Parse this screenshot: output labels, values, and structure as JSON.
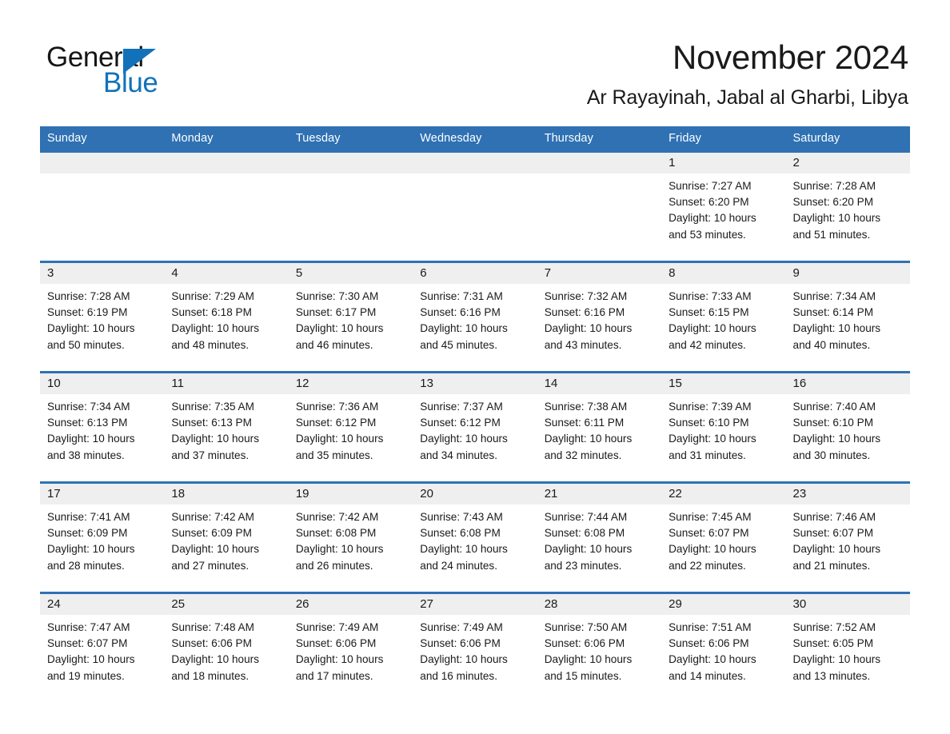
{
  "brand": {
    "name_top": "General",
    "name_bottom": "Blue",
    "accent_color": "#1272b9"
  },
  "header": {
    "title": "November 2024",
    "location": "Ar Rayayinah, Jabal al Gharbi, Libya"
  },
  "theme": {
    "header_blue": "#2f71b3",
    "day_band_gray": "#efefef",
    "text_color": "#1a1a1a"
  },
  "weekdays": [
    "Sunday",
    "Monday",
    "Tuesday",
    "Wednesday",
    "Thursday",
    "Friday",
    "Saturday"
  ],
  "weeks": [
    [
      {
        "day": "",
        "sunrise": "",
        "sunset": "",
        "daylight_line1": "",
        "daylight_line2": "",
        "empty": true
      },
      {
        "day": "",
        "sunrise": "",
        "sunset": "",
        "daylight_line1": "",
        "daylight_line2": "",
        "empty": true
      },
      {
        "day": "",
        "sunrise": "",
        "sunset": "",
        "daylight_line1": "",
        "daylight_line2": "",
        "empty": true
      },
      {
        "day": "",
        "sunrise": "",
        "sunset": "",
        "daylight_line1": "",
        "daylight_line2": "",
        "empty": true
      },
      {
        "day": "",
        "sunrise": "",
        "sunset": "",
        "daylight_line1": "",
        "daylight_line2": "",
        "empty": true
      },
      {
        "day": "1",
        "sunrise": "Sunrise: 7:27 AM",
        "sunset": "Sunset: 6:20 PM",
        "daylight_line1": "Daylight: 10 hours",
        "daylight_line2": "and 53 minutes.",
        "empty": false
      },
      {
        "day": "2",
        "sunrise": "Sunrise: 7:28 AM",
        "sunset": "Sunset: 6:20 PM",
        "daylight_line1": "Daylight: 10 hours",
        "daylight_line2": "and 51 minutes.",
        "empty": false
      }
    ],
    [
      {
        "day": "3",
        "sunrise": "Sunrise: 7:28 AM",
        "sunset": "Sunset: 6:19 PM",
        "daylight_line1": "Daylight: 10 hours",
        "daylight_line2": "and 50 minutes.",
        "empty": false
      },
      {
        "day": "4",
        "sunrise": "Sunrise: 7:29 AM",
        "sunset": "Sunset: 6:18 PM",
        "daylight_line1": "Daylight: 10 hours",
        "daylight_line2": "and 48 minutes.",
        "empty": false
      },
      {
        "day": "5",
        "sunrise": "Sunrise: 7:30 AM",
        "sunset": "Sunset: 6:17 PM",
        "daylight_line1": "Daylight: 10 hours",
        "daylight_line2": "and 46 minutes.",
        "empty": false
      },
      {
        "day": "6",
        "sunrise": "Sunrise: 7:31 AM",
        "sunset": "Sunset: 6:16 PM",
        "daylight_line1": "Daylight: 10 hours",
        "daylight_line2": "and 45 minutes.",
        "empty": false
      },
      {
        "day": "7",
        "sunrise": "Sunrise: 7:32 AM",
        "sunset": "Sunset: 6:16 PM",
        "daylight_line1": "Daylight: 10 hours",
        "daylight_line2": "and 43 minutes.",
        "empty": false
      },
      {
        "day": "8",
        "sunrise": "Sunrise: 7:33 AM",
        "sunset": "Sunset: 6:15 PM",
        "daylight_line1": "Daylight: 10 hours",
        "daylight_line2": "and 42 minutes.",
        "empty": false
      },
      {
        "day": "9",
        "sunrise": "Sunrise: 7:34 AM",
        "sunset": "Sunset: 6:14 PM",
        "daylight_line1": "Daylight: 10 hours",
        "daylight_line2": "and 40 minutes.",
        "empty": false
      }
    ],
    [
      {
        "day": "10",
        "sunrise": "Sunrise: 7:34 AM",
        "sunset": "Sunset: 6:13 PM",
        "daylight_line1": "Daylight: 10 hours",
        "daylight_line2": "and 38 minutes.",
        "empty": false
      },
      {
        "day": "11",
        "sunrise": "Sunrise: 7:35 AM",
        "sunset": "Sunset: 6:13 PM",
        "daylight_line1": "Daylight: 10 hours",
        "daylight_line2": "and 37 minutes.",
        "empty": false
      },
      {
        "day": "12",
        "sunrise": "Sunrise: 7:36 AM",
        "sunset": "Sunset: 6:12 PM",
        "daylight_line1": "Daylight: 10 hours",
        "daylight_line2": "and 35 minutes.",
        "empty": false
      },
      {
        "day": "13",
        "sunrise": "Sunrise: 7:37 AM",
        "sunset": "Sunset: 6:12 PM",
        "daylight_line1": "Daylight: 10 hours",
        "daylight_line2": "and 34 minutes.",
        "empty": false
      },
      {
        "day": "14",
        "sunrise": "Sunrise: 7:38 AM",
        "sunset": "Sunset: 6:11 PM",
        "daylight_line1": "Daylight: 10 hours",
        "daylight_line2": "and 32 minutes.",
        "empty": false
      },
      {
        "day": "15",
        "sunrise": "Sunrise: 7:39 AM",
        "sunset": "Sunset: 6:10 PM",
        "daylight_line1": "Daylight: 10 hours",
        "daylight_line2": "and 31 minutes.",
        "empty": false
      },
      {
        "day": "16",
        "sunrise": "Sunrise: 7:40 AM",
        "sunset": "Sunset: 6:10 PM",
        "daylight_line1": "Daylight: 10 hours",
        "daylight_line2": "and 30 minutes.",
        "empty": false
      }
    ],
    [
      {
        "day": "17",
        "sunrise": "Sunrise: 7:41 AM",
        "sunset": "Sunset: 6:09 PM",
        "daylight_line1": "Daylight: 10 hours",
        "daylight_line2": "and 28 minutes.",
        "empty": false
      },
      {
        "day": "18",
        "sunrise": "Sunrise: 7:42 AM",
        "sunset": "Sunset: 6:09 PM",
        "daylight_line1": "Daylight: 10 hours",
        "daylight_line2": "and 27 minutes.",
        "empty": false
      },
      {
        "day": "19",
        "sunrise": "Sunrise: 7:42 AM",
        "sunset": "Sunset: 6:08 PM",
        "daylight_line1": "Daylight: 10 hours",
        "daylight_line2": "and 26 minutes.",
        "empty": false
      },
      {
        "day": "20",
        "sunrise": "Sunrise: 7:43 AM",
        "sunset": "Sunset: 6:08 PM",
        "daylight_line1": "Daylight: 10 hours",
        "daylight_line2": "and 24 minutes.",
        "empty": false
      },
      {
        "day": "21",
        "sunrise": "Sunrise: 7:44 AM",
        "sunset": "Sunset: 6:08 PM",
        "daylight_line1": "Daylight: 10 hours",
        "daylight_line2": "and 23 minutes.",
        "empty": false
      },
      {
        "day": "22",
        "sunrise": "Sunrise: 7:45 AM",
        "sunset": "Sunset: 6:07 PM",
        "daylight_line1": "Daylight: 10 hours",
        "daylight_line2": "and 22 minutes.",
        "empty": false
      },
      {
        "day": "23",
        "sunrise": "Sunrise: 7:46 AM",
        "sunset": "Sunset: 6:07 PM",
        "daylight_line1": "Daylight: 10 hours",
        "daylight_line2": "and 21 minutes.",
        "empty": false
      }
    ],
    [
      {
        "day": "24",
        "sunrise": "Sunrise: 7:47 AM",
        "sunset": "Sunset: 6:07 PM",
        "daylight_line1": "Daylight: 10 hours",
        "daylight_line2": "and 19 minutes.",
        "empty": false
      },
      {
        "day": "25",
        "sunrise": "Sunrise: 7:48 AM",
        "sunset": "Sunset: 6:06 PM",
        "daylight_line1": "Daylight: 10 hours",
        "daylight_line2": "and 18 minutes.",
        "empty": false
      },
      {
        "day": "26",
        "sunrise": "Sunrise: 7:49 AM",
        "sunset": "Sunset: 6:06 PM",
        "daylight_line1": "Daylight: 10 hours",
        "daylight_line2": "and 17 minutes.",
        "empty": false
      },
      {
        "day": "27",
        "sunrise": "Sunrise: 7:49 AM",
        "sunset": "Sunset: 6:06 PM",
        "daylight_line1": "Daylight: 10 hours",
        "daylight_line2": "and 16 minutes.",
        "empty": false
      },
      {
        "day": "28",
        "sunrise": "Sunrise: 7:50 AM",
        "sunset": "Sunset: 6:06 PM",
        "daylight_line1": "Daylight: 10 hours",
        "daylight_line2": "and 15 minutes.",
        "empty": false
      },
      {
        "day": "29",
        "sunrise": "Sunrise: 7:51 AM",
        "sunset": "Sunset: 6:06 PM",
        "daylight_line1": "Daylight: 10 hours",
        "daylight_line2": "and 14 minutes.",
        "empty": false
      },
      {
        "day": "30",
        "sunrise": "Sunrise: 7:52 AM",
        "sunset": "Sunset: 6:05 PM",
        "daylight_line1": "Daylight: 10 hours",
        "daylight_line2": "and 13 minutes.",
        "empty": false
      }
    ]
  ]
}
